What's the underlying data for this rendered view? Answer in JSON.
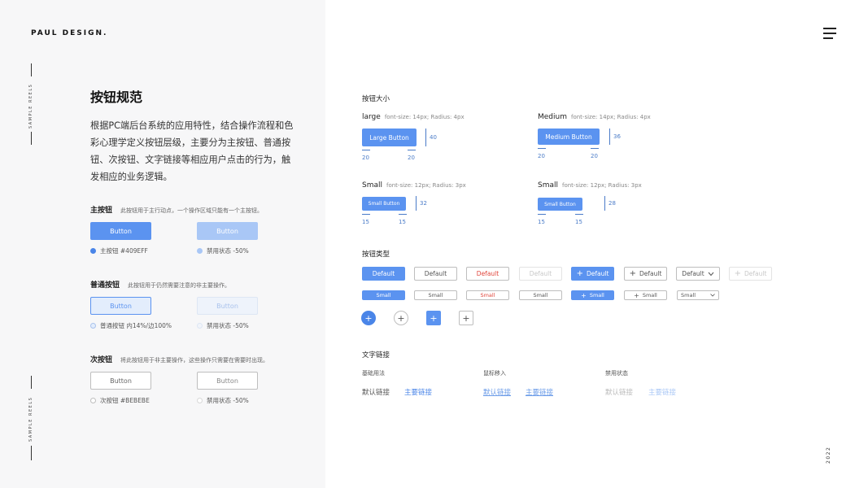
{
  "brand": "PAUL DESIGN.",
  "side_text_top": "SAMPLE REELS",
  "side_text_bottom": "SAMPLE REELS",
  "year": "2022",
  "left": {
    "title": "按钮规范",
    "description": "根据PC端后台系统的应用特性，结合操作流程和色彩心理学定义按钮层级，主要分为主按钮、普通按钮、次按钮、文字链接等相应用户点击的行为，触发相应的业务逻辑。",
    "primary": {
      "title": "主按钮",
      "desc": "此按钮用于主行动点，一个操作区域只能有一个主按钮。",
      "btn": "Button",
      "btn_disabled": "Button",
      "note": "主按钮 #409EFF",
      "note_disabled": "禁用状态 -50%"
    },
    "normal": {
      "title": "普通按钮",
      "desc": "此按钮用于仍然需要注意的非主要操作。",
      "btn": "Button",
      "btn_disabled": "Button",
      "note": "普通按钮 内14%/边100%",
      "note_disabled": "禁用状态 -50%"
    },
    "secondary": {
      "title": "次按钮",
      "desc": "将此按钮用于非主要操作，这些操作只需要在需要时出现。",
      "btn": "Button",
      "btn_disabled": "Button",
      "note": "次按钮 #BEBEBE",
      "note_disabled": "禁用状态 -50%"
    }
  },
  "sizes": {
    "title": "按钮大小",
    "large": {
      "name": "large",
      "spec": "font-size: 14px; Radius: 4px",
      "btn": "Large Button",
      "height": "40",
      "pad_l": "20",
      "pad_r": "20"
    },
    "medium": {
      "name": "Medium",
      "spec": "font-size: 14px; Radius: 4px",
      "btn": "Medium Button",
      "height": "36",
      "pad_l": "20",
      "pad_r": "20"
    },
    "small": {
      "name": "Small",
      "spec": "font-size: 12px; Radius: 3px",
      "btn": "Small Button",
      "height": "32",
      "pad_l": "15",
      "pad_r": "15"
    },
    "small2": {
      "name": "Small",
      "spec": "font-size: 12px; Radius: 3px",
      "btn": "Small Button",
      "height": "28",
      "pad_l": "15",
      "pad_r": "15"
    }
  },
  "types": {
    "title": "按钮类型",
    "row1": [
      "Default",
      "Default",
      "Default",
      "Default",
      "Default",
      "Default",
      "Default",
      "Default"
    ],
    "row2": [
      "Small",
      "Small",
      "Small",
      "Small",
      "Small",
      "Small",
      "Small"
    ],
    "plus": "+",
    "chevron": "v"
  },
  "links": {
    "title": "文字链接",
    "col1": {
      "label": "基础用法",
      "default": "默认链接",
      "primary": "主要链接"
    },
    "col2": {
      "label": "鼠标移入",
      "default": "默认链接",
      "primary": "主要链接"
    },
    "col3": {
      "label": "禁用状态",
      "default": "默认链接",
      "primary": "主要链接"
    }
  },
  "colors": {
    "primary": "#409EFF",
    "primary_btn": "#5b93f0",
    "danger": "#e0453b",
    "border": "#bebebe"
  }
}
